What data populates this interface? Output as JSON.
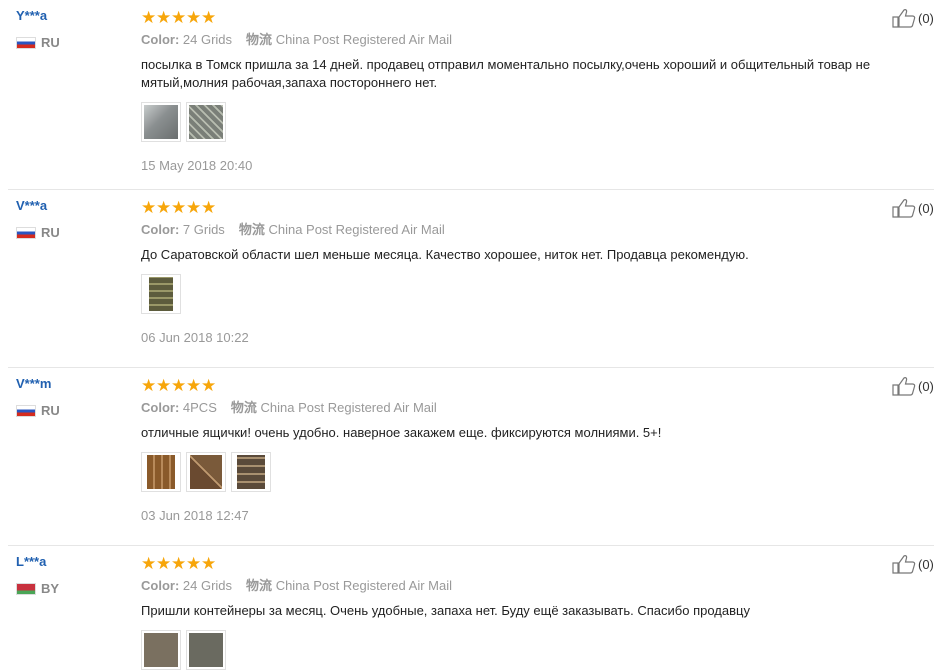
{
  "reviews": [
    {
      "user": "Y***a",
      "country": "RU",
      "flag": "ru",
      "rating": 5,
      "color_label": "Color:",
      "color_value": "24 Grids",
      "shipping_label": "物流",
      "shipping_value": "China Post Registered Air Mail",
      "text": "посылка в Томск пришла за 14 дней. продавец отправил моментально посылку,очень хороший и общительный товар не мятый,молния рабочая,запаха постороннего нет.",
      "thumb_colors": [
        "#8a8f90",
        "#6f7470"
      ],
      "date": "15 May 2018 20:40",
      "likes": "(0)"
    },
    {
      "user": "V***a",
      "country": "RU",
      "flag": "ru",
      "rating": 5,
      "color_label": "Color:",
      "color_value": "7 Grids",
      "shipping_label": "物流",
      "shipping_value": "China Post Registered Air Mail",
      "text": "До Саратовской области шел меньше месяца. Качество хорошее, ниток нет. Продавца рекомендую.",
      "thumb_colors": [
        "#6b6a48"
      ],
      "date": "06 Jun 2018 10:22",
      "likes": "(0)"
    },
    {
      "user": "V***m",
      "country": "RU",
      "flag": "ru",
      "rating": 5,
      "color_label": "Color:",
      "color_value": "4PCS",
      "shipping_label": "物流",
      "shipping_value": "China Post Registered Air Mail",
      "text": "отличные ящички! очень удобно. наверное закажем еще. фиксируются молниями. 5+!",
      "thumb_colors": [
        "#9a6a3a",
        "#8c6a4a",
        "#7a6a55"
      ],
      "date": "03 Jun 2018 12:47",
      "likes": "(0)"
    },
    {
      "user": "L***a",
      "country": "BY",
      "flag": "by",
      "rating": 5,
      "color_label": "Color:",
      "color_value": "24 Grids",
      "shipping_label": "物流",
      "shipping_value": "China Post Registered Air Mail",
      "text": "Пришли контейнеры за месяц. Очень удобные, запаха нет. Буду ещё заказывать. Спасибо продавцу",
      "thumb_colors": [
        "#7a7060",
        "#6a6a60"
      ],
      "date": "",
      "likes": "(0)"
    }
  ]
}
